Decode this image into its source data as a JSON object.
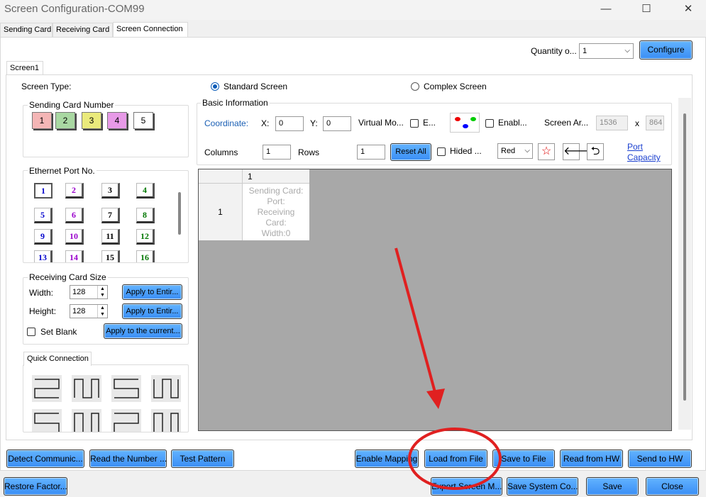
{
  "window": {
    "title": "Screen Configuration-COM99",
    "minimize": "—",
    "maximize": "☐",
    "close": "✕"
  },
  "tabs": [
    "Sending Card",
    "Receiving Card",
    "Screen Connection"
  ],
  "quantity": {
    "label": "Quantity o...",
    "value": "1",
    "configure": "Configure"
  },
  "screen_tab": "Screen1",
  "screen_type": {
    "label": "Screen Type:",
    "standard": "Standard Screen",
    "complex": "Complex Screen",
    "selected": "standard"
  },
  "sending_card_number": {
    "title": "Sending Card Number",
    "items": [
      {
        "label": "1",
        "color": "#f4b6b6"
      },
      {
        "label": "2",
        "color": "#a9d8a2"
      },
      {
        "label": "3",
        "color": "#eaea7c"
      },
      {
        "label": "4",
        "color": "#e79ae7"
      },
      {
        "label": "5",
        "color": "#ffffff"
      }
    ]
  },
  "ethernet_port": {
    "title": "Ethernet Port No.",
    "ports": [
      {
        "label": "1",
        "color": "#0000cc"
      },
      {
        "label": "2",
        "color": "#9900cc"
      },
      {
        "label": "3",
        "color": "#000000"
      },
      {
        "label": "4",
        "color": "#007700"
      },
      {
        "label": "5",
        "color": "#0000cc"
      },
      {
        "label": "6",
        "color": "#9900cc"
      },
      {
        "label": "7",
        "color": "#000000"
      },
      {
        "label": "8",
        "color": "#007700"
      },
      {
        "label": "9",
        "color": "#0000cc"
      },
      {
        "label": "10",
        "color": "#9900cc"
      },
      {
        "label": "11",
        "color": "#000000"
      },
      {
        "label": "12",
        "color": "#007700"
      },
      {
        "label": "13",
        "color": "#0000cc"
      },
      {
        "label": "14",
        "color": "#9900cc"
      },
      {
        "label": "15",
        "color": "#000000"
      },
      {
        "label": "16",
        "color": "#007700"
      }
    ]
  },
  "receiving_card_size": {
    "title": "Receiving Card Size",
    "width_label": "Width:",
    "width": "128",
    "height_label": "Height:",
    "height": "128",
    "apply_width": "Apply to Entir...",
    "apply_height": "Apply to Entir...",
    "set_blank": "Set Blank",
    "apply_current": "Apply to the current..."
  },
  "quick_connection": {
    "title": "Quick Connection"
  },
  "basic_info": {
    "title": "Basic Information",
    "coordinate": "Coordinate:",
    "x_label": "X:",
    "x": "0",
    "y_label": "Y:",
    "y": "0",
    "virtual_mode": "Virtual Mo...",
    "e_label": "E...",
    "enable_label": "Enabl...",
    "screen_area": "Screen Ar...",
    "area_w": "1536",
    "area_x": "x",
    "area_h": "864",
    "columns_label": "Columns",
    "columns": "1",
    "rows_label": "Rows",
    "rows": "1",
    "reset_all": "Reset All",
    "hided": "Hided ...",
    "color_select": "Red",
    "port_capacity_1": "Port",
    "port_capacity_2": "Capacity"
  },
  "grid": {
    "col_header": "1",
    "row_header": "1",
    "cell_lines": [
      "Sending Card:",
      "Port:",
      "Receiving",
      "Card:",
      "Width:0"
    ]
  },
  "bottom_row1": [
    "Detect Communic...",
    "Read the Number ...",
    "Test Pattern",
    "Enable Mapping",
    "Load from File",
    "Save to File",
    "Read from HW",
    "Send to HW"
  ],
  "bottom_row2": [
    "Restore Factor...",
    "Export Screen M...",
    "Save System Co...",
    "Save",
    "Close"
  ],
  "annotation_color": "#e02020"
}
